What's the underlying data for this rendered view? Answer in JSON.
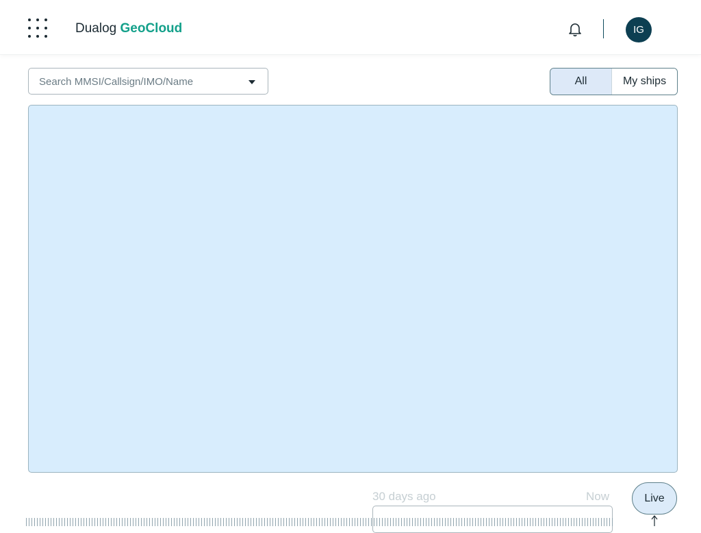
{
  "header": {
    "brand_prefix": "Dualog",
    "brand_suffix": "GeoCloud",
    "avatar_initials": "IG",
    "icons": [
      "apps-grid-icon",
      "bell-icon"
    ]
  },
  "search": {
    "placeholder": "Search MMSI/Callsign/IMO/Name",
    "value": ""
  },
  "filter": {
    "options": [
      "All",
      "My ships"
    ],
    "selected": "All"
  },
  "timeline": {
    "start_label": "30 days ago",
    "end_label": "Now",
    "live_label": "Live"
  },
  "colors": {
    "brand_accent": "#13a08a",
    "avatar_bg": "#0d3f52",
    "map_water": "#d8edfd",
    "toggle_selected": "#dde9f8"
  }
}
